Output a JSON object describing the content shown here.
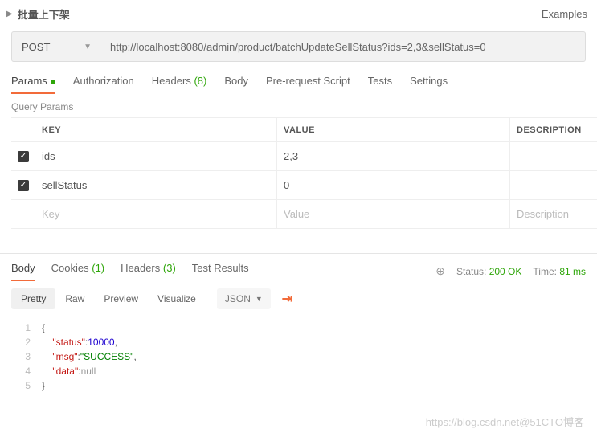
{
  "header": {
    "title": "批量上下架",
    "examples": "Examples"
  },
  "request": {
    "method": "POST",
    "url": "http://localhost:8080/admin/product/batchUpdateSellStatus?ids=2,3&sellStatus=0"
  },
  "tabs": {
    "params": "Params",
    "auth": "Authorization",
    "headers": "Headers",
    "headers_count": "(8)",
    "body": "Body",
    "prereq": "Pre-request Script",
    "tests": "Tests",
    "settings": "Settings"
  },
  "query": {
    "title": "Query Params",
    "cols": {
      "key": "KEY",
      "value": "VALUE",
      "desc": "DESCRIPTION"
    },
    "rows": [
      {
        "key": "ids",
        "value": "2,3"
      },
      {
        "key": "sellStatus",
        "value": "0"
      }
    ],
    "ph": {
      "key": "Key",
      "value": "Value",
      "desc": "Description"
    }
  },
  "resp_tabs": {
    "body": "Body",
    "cookies": "Cookies",
    "cookies_count": "(1)",
    "headers": "Headers",
    "headers_count": "(3)",
    "results": "Test Results"
  },
  "status": {
    "label": "Status:",
    "code": "200 OK",
    "time_label": "Time:",
    "time": "81 ms"
  },
  "viewer": {
    "pretty": "Pretty",
    "raw": "Raw",
    "preview": "Preview",
    "visualize": "Visualize",
    "format": "JSON"
  },
  "json_body": {
    "l1": "{",
    "l2k": "\"status\"",
    "l2v": "10000",
    "l3k": "\"msg\"",
    "l3v": "\"SUCCESS\"",
    "l4k": "\"data\"",
    "l4v": "null",
    "l5": "}"
  },
  "watermark": "https://blog.csdn.net@51CTO博客"
}
